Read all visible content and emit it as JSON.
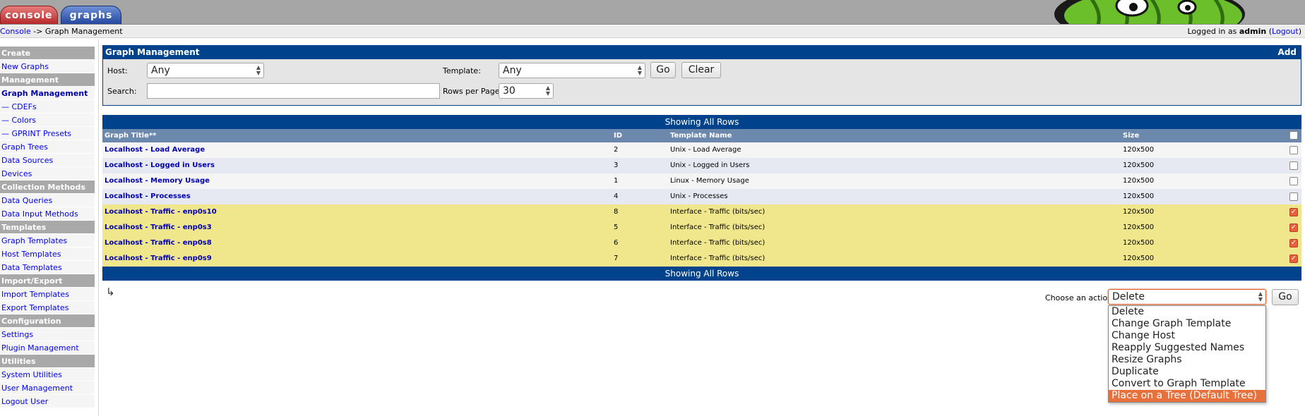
{
  "topbar": {
    "tab_console": "console",
    "tab_graphs": "graphs"
  },
  "nav": {
    "crumb_link": "Console",
    "crumb_rest": " -> Graph Management",
    "login_prefix": "Logged in as ",
    "user": "admin",
    "logout": "Logout"
  },
  "sidebar": {
    "items": [
      {
        "type": "head",
        "label": "Create"
      },
      {
        "type": "link",
        "label": "New Graphs"
      },
      {
        "type": "head",
        "label": "Management"
      },
      {
        "type": "link",
        "label": "Graph Management",
        "active": true
      },
      {
        "type": "link",
        "label": "— CDEFs"
      },
      {
        "type": "link",
        "label": "— Colors"
      },
      {
        "type": "link",
        "label": "— GPRINT Presets"
      },
      {
        "type": "link",
        "label": "Graph Trees"
      },
      {
        "type": "link",
        "label": "Data Sources"
      },
      {
        "type": "link",
        "label": "Devices"
      },
      {
        "type": "head",
        "label": "Collection Methods"
      },
      {
        "type": "link",
        "label": "Data Queries"
      },
      {
        "type": "link",
        "label": "Data Input Methods"
      },
      {
        "type": "head",
        "label": "Templates"
      },
      {
        "type": "link",
        "label": "Graph Templates"
      },
      {
        "type": "link",
        "label": "Host Templates"
      },
      {
        "type": "link",
        "label": "Data Templates"
      },
      {
        "type": "head",
        "label": "Import/Export"
      },
      {
        "type": "link",
        "label": "Import Templates"
      },
      {
        "type": "link",
        "label": "Export Templates"
      },
      {
        "type": "head",
        "label": "Configuration"
      },
      {
        "type": "link",
        "label": "Settings"
      },
      {
        "type": "link",
        "label": "Plugin Management"
      },
      {
        "type": "head",
        "label": "Utilities"
      },
      {
        "type": "link",
        "label": "System Utilities"
      },
      {
        "type": "link",
        "label": "User Management"
      },
      {
        "type": "link",
        "label": "Logout User"
      }
    ]
  },
  "filter": {
    "title": "Graph Management",
    "add": "Add",
    "host_label": "Host:",
    "host_value": "Any",
    "template_label": "Template:",
    "template_value": "Any",
    "go": "Go",
    "clear": "Clear",
    "search_label": "Search:",
    "search_value": "",
    "rows_label": "Rows per Page:",
    "rows_value": "30"
  },
  "table": {
    "band_top": "Showing All Rows",
    "band_bottom": "Showing All Rows",
    "headers": {
      "title": "Graph Title**",
      "id": "ID",
      "template": "Template Name",
      "size": "Size"
    },
    "rows": [
      {
        "title": "Localhost - Load Average",
        "id": "2",
        "template": "Unix - Load Average",
        "size": "120x500",
        "checked": false
      },
      {
        "title": "Localhost - Logged in Users",
        "id": "3",
        "template": "Unix - Logged in Users",
        "size": "120x500",
        "checked": false
      },
      {
        "title": "Localhost - Memory Usage",
        "id": "1",
        "template": "Linux - Memory Usage",
        "size": "120x500",
        "checked": false
      },
      {
        "title": "Localhost - Processes",
        "id": "4",
        "template": "Unix - Processes",
        "size": "120x500",
        "checked": false
      },
      {
        "title": "Localhost - Traffic - enp0s10",
        "id": "8",
        "template": "Interface - Traffic (bits/sec)",
        "size": "120x500",
        "checked": true
      },
      {
        "title": "Localhost - Traffic - enp0s3",
        "id": "5",
        "template": "Interface - Traffic (bits/sec)",
        "size": "120x500",
        "checked": true
      },
      {
        "title": "Localhost - Traffic - enp0s8",
        "id": "6",
        "template": "Interface - Traffic (bits/sec)",
        "size": "120x500",
        "checked": true
      },
      {
        "title": "Localhost - Traffic - enp0s9",
        "id": "7",
        "template": "Interface - Traffic (bits/sec)",
        "size": "120x500",
        "checked": true
      }
    ]
  },
  "actions": {
    "label": "Choose an action:",
    "selected": "Delete",
    "go": "Go",
    "options": [
      "Delete",
      "Change Graph Template",
      "Change Host",
      "Reapply Suggested Names",
      "Resize Graphs",
      "Duplicate",
      "Convert to Graph Template",
      "Place on a Tree (Default Tree)"
    ],
    "highlighted_index": 7
  },
  "colors": {
    "header_blue": "#00438c",
    "selected_row": "#f0e68c",
    "highlight": "#e8703c"
  }
}
